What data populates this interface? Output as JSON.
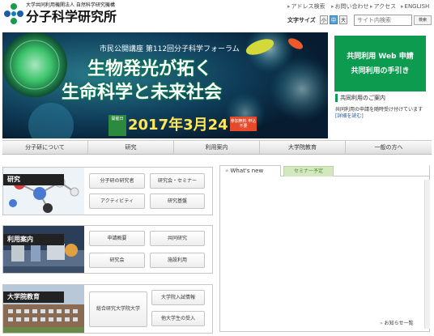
{
  "header": {
    "org_line": "大学共同利用機関法人 自然科学研究機構",
    "site_title": "分子科学研究所",
    "util_links": [
      "アドレス検索",
      "お問い合わせ",
      "アクセス",
      "ENGLISH"
    ],
    "font_size_label": "文字サイズ",
    "font_sizes": [
      "小",
      "中",
      "大"
    ],
    "search_placeholder": "サイト内検索",
    "search_button": "検索"
  },
  "banner": {
    "series_title": "市民公開講座 第112回分子科学フォーラム",
    "headline_1": "生物発光が拓く",
    "headline_2": "生命科学と未来社会",
    "badge": "開催日",
    "date": "2017年3月24日",
    "entry_badge": "参加無料 申込不要"
  },
  "joint_use": {
    "green_line1": "共同利用 Web 申請",
    "green_line2": "共同利用の手引き",
    "info_title": "共同利用のご案内",
    "info_body": "共同利用の申請を随時受け付けています",
    "info_link": "[詳細を読む]"
  },
  "nav": [
    "分子研について",
    "研究",
    "利用案内",
    "大学院教育",
    "一般の方へ"
  ],
  "panels": [
    {
      "title": "研究",
      "buttons": [
        "分子研の研究者",
        "研究会・セミナー",
        "アクティビティ",
        "研究基盤"
      ]
    },
    {
      "title": "利用案内",
      "buttons": [
        "申請概要",
        "共同研究",
        "研究会",
        "施設利用"
      ]
    },
    {
      "title": "大学院教育",
      "buttons": [
        "総合研究大学院大学",
        "大学院入試情報",
        "他大学生の受入"
      ]
    }
  ],
  "news": {
    "tab_active": "What's new",
    "tab_inactive": "セミナー予定",
    "more_link": "お知らせ一覧"
  },
  "colors": {
    "accent_green": "#0c9b4f",
    "banner_bg": "#0d2f4f",
    "date_yellow": "#ffe65a"
  }
}
